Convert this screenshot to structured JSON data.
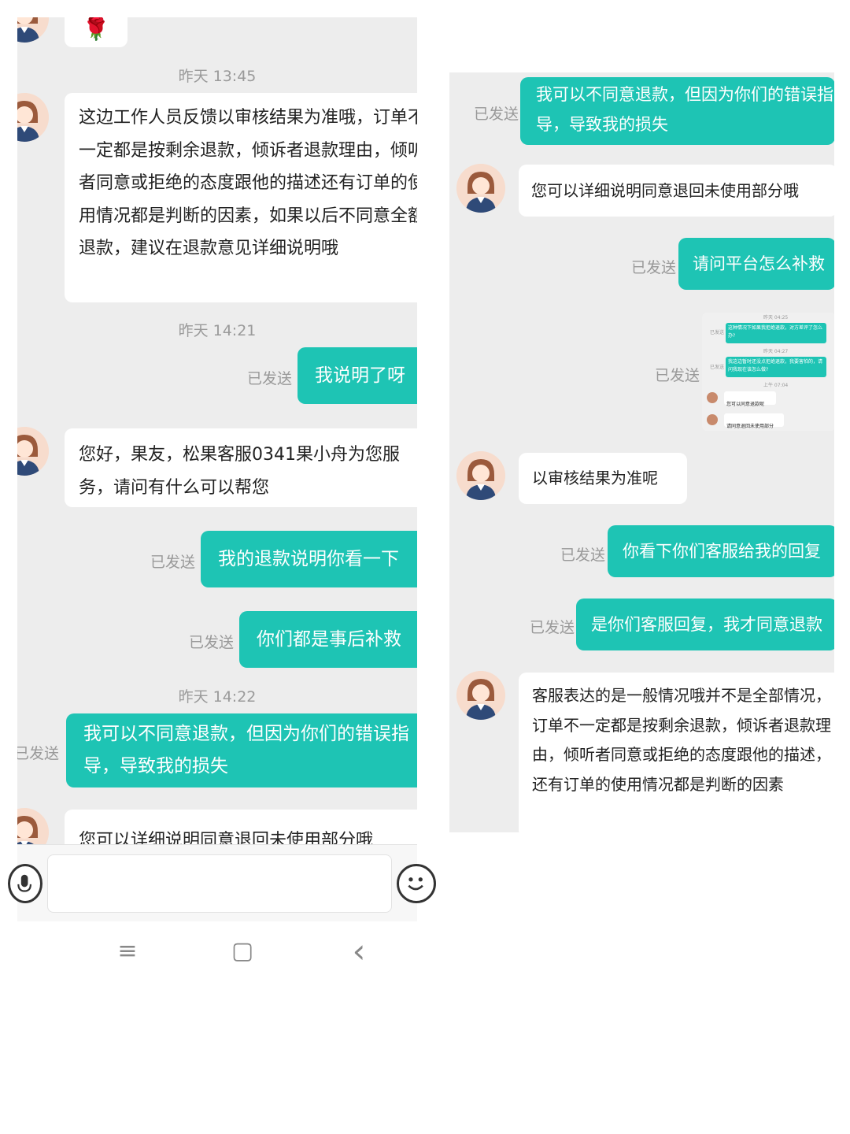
{
  "colors": {
    "sent_bubble": "#1ec4b4",
    "received_bubble": "#ffffff",
    "chat_background": "#ededed",
    "timestamp_text": "#9a9a9a"
  },
  "left_chat": {
    "top_sticker": "🌹",
    "time_1": "昨天 13:45",
    "msg_1": "这边工作人员反馈以审核结果为准哦，订单不一定都是按剩余退款，倾诉者退款理由，倾听者同意或拒绝的态度跟他的描述还有订单的使用情况都是判断的因素，如果以后不同意全额退款，建议在退款意见详细说明哦",
    "time_2": "昨天 14:21",
    "msg_2": "我说明了呀",
    "msg_2_status": "已发送",
    "msg_3": "您好，果友，松果客服0341果小舟为您服务，请问有什么可以帮您",
    "msg_4": "我的退款说明你看一下",
    "msg_4_status": "已发送",
    "msg_5": "你们都是事后补救",
    "msg_5_status": "已发送",
    "time_3": "昨天 14:22",
    "msg_6": "我可以不同意退款，但因为你们的错误指导，导致我的损失",
    "msg_6_status": "已发送",
    "msg_7": "您可以详细说明同意退回未使用部分哦"
  },
  "input_bar": {
    "voice_icon": "microphone-icon",
    "emoji_icon": "smiley-icon"
  },
  "nav_bar": {
    "menu_icon": "≡",
    "home_icon": "▢",
    "back_icon": "‹"
  },
  "right_chat": {
    "msg_1": "我可以不同意退款，但因为你们的错误指导，导致我的损失",
    "msg_1_status": "已发送",
    "msg_2": "您可以详细说明同意退回未使用部分哦",
    "msg_3": "请问平台怎么补救",
    "msg_3_status": "已发送",
    "msg_4_status": "已发送",
    "thumb": {
      "t1": "昨天 04:25",
      "b1": "这种情况下如果我拒绝退款，对方差评了怎么办?",
      "s1": "已发送",
      "t2": "昨天 04:27",
      "b2": "我这边暂时还没点拒绝退款，我要害怕的，请问我现在该怎么做?",
      "s2": "已发送",
      "t3": "上午 07:04",
      "r1": "您可以同意退款呢",
      "r2": "请同意退回未使用部分"
    },
    "msg_5": "以审核结果为准呢",
    "msg_6": "你看下你们客服给我的回复",
    "msg_6_status": "已发送",
    "msg_7": "是你们客服回复，我才同意退款",
    "msg_7_status": "已发送",
    "msg_8": "客服表达的是一般情况哦并不是全部情况，订单不一定都是按剩余退款，倾诉者退款理由，倾听者同意或拒绝的态度跟他的描述，还有订单的使用情况都是判断的因素"
  }
}
